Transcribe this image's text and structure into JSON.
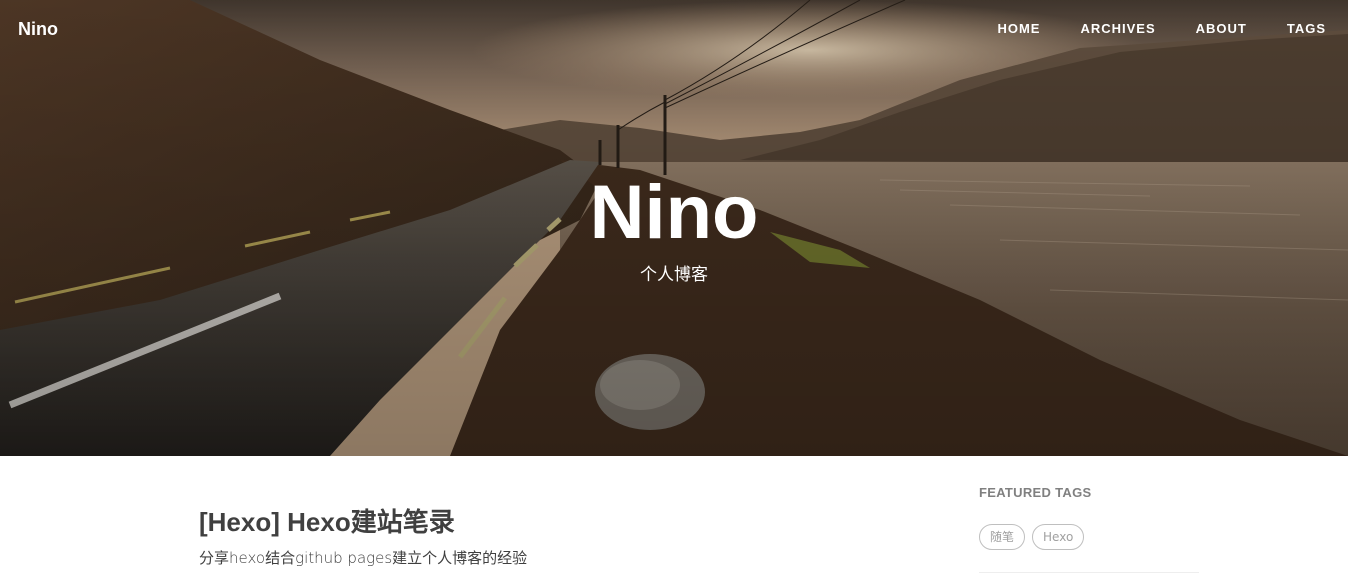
{
  "navbar": {
    "brand": "Nino",
    "links": [
      {
        "label": "HOME"
      },
      {
        "label": "ARCHIVES"
      },
      {
        "label": "ABOUT"
      },
      {
        "label": "TAGS"
      }
    ]
  },
  "hero": {
    "title": "Nino",
    "subtitle": "个人博客"
  },
  "posts": [
    {
      "title": "[Hexo] Hexo建站笔录",
      "subtitle": "分享hexo结合github pages建立个人博客的经验"
    }
  ],
  "sidebar": {
    "featured_tags_heading": "FEATURED TAGS",
    "tags": [
      {
        "label": "随笔"
      },
      {
        "label": "Hexo"
      }
    ]
  },
  "colors": {
    "text_dark": "#404040",
    "text_muted": "#808080",
    "hero_text": "#ffffff"
  }
}
